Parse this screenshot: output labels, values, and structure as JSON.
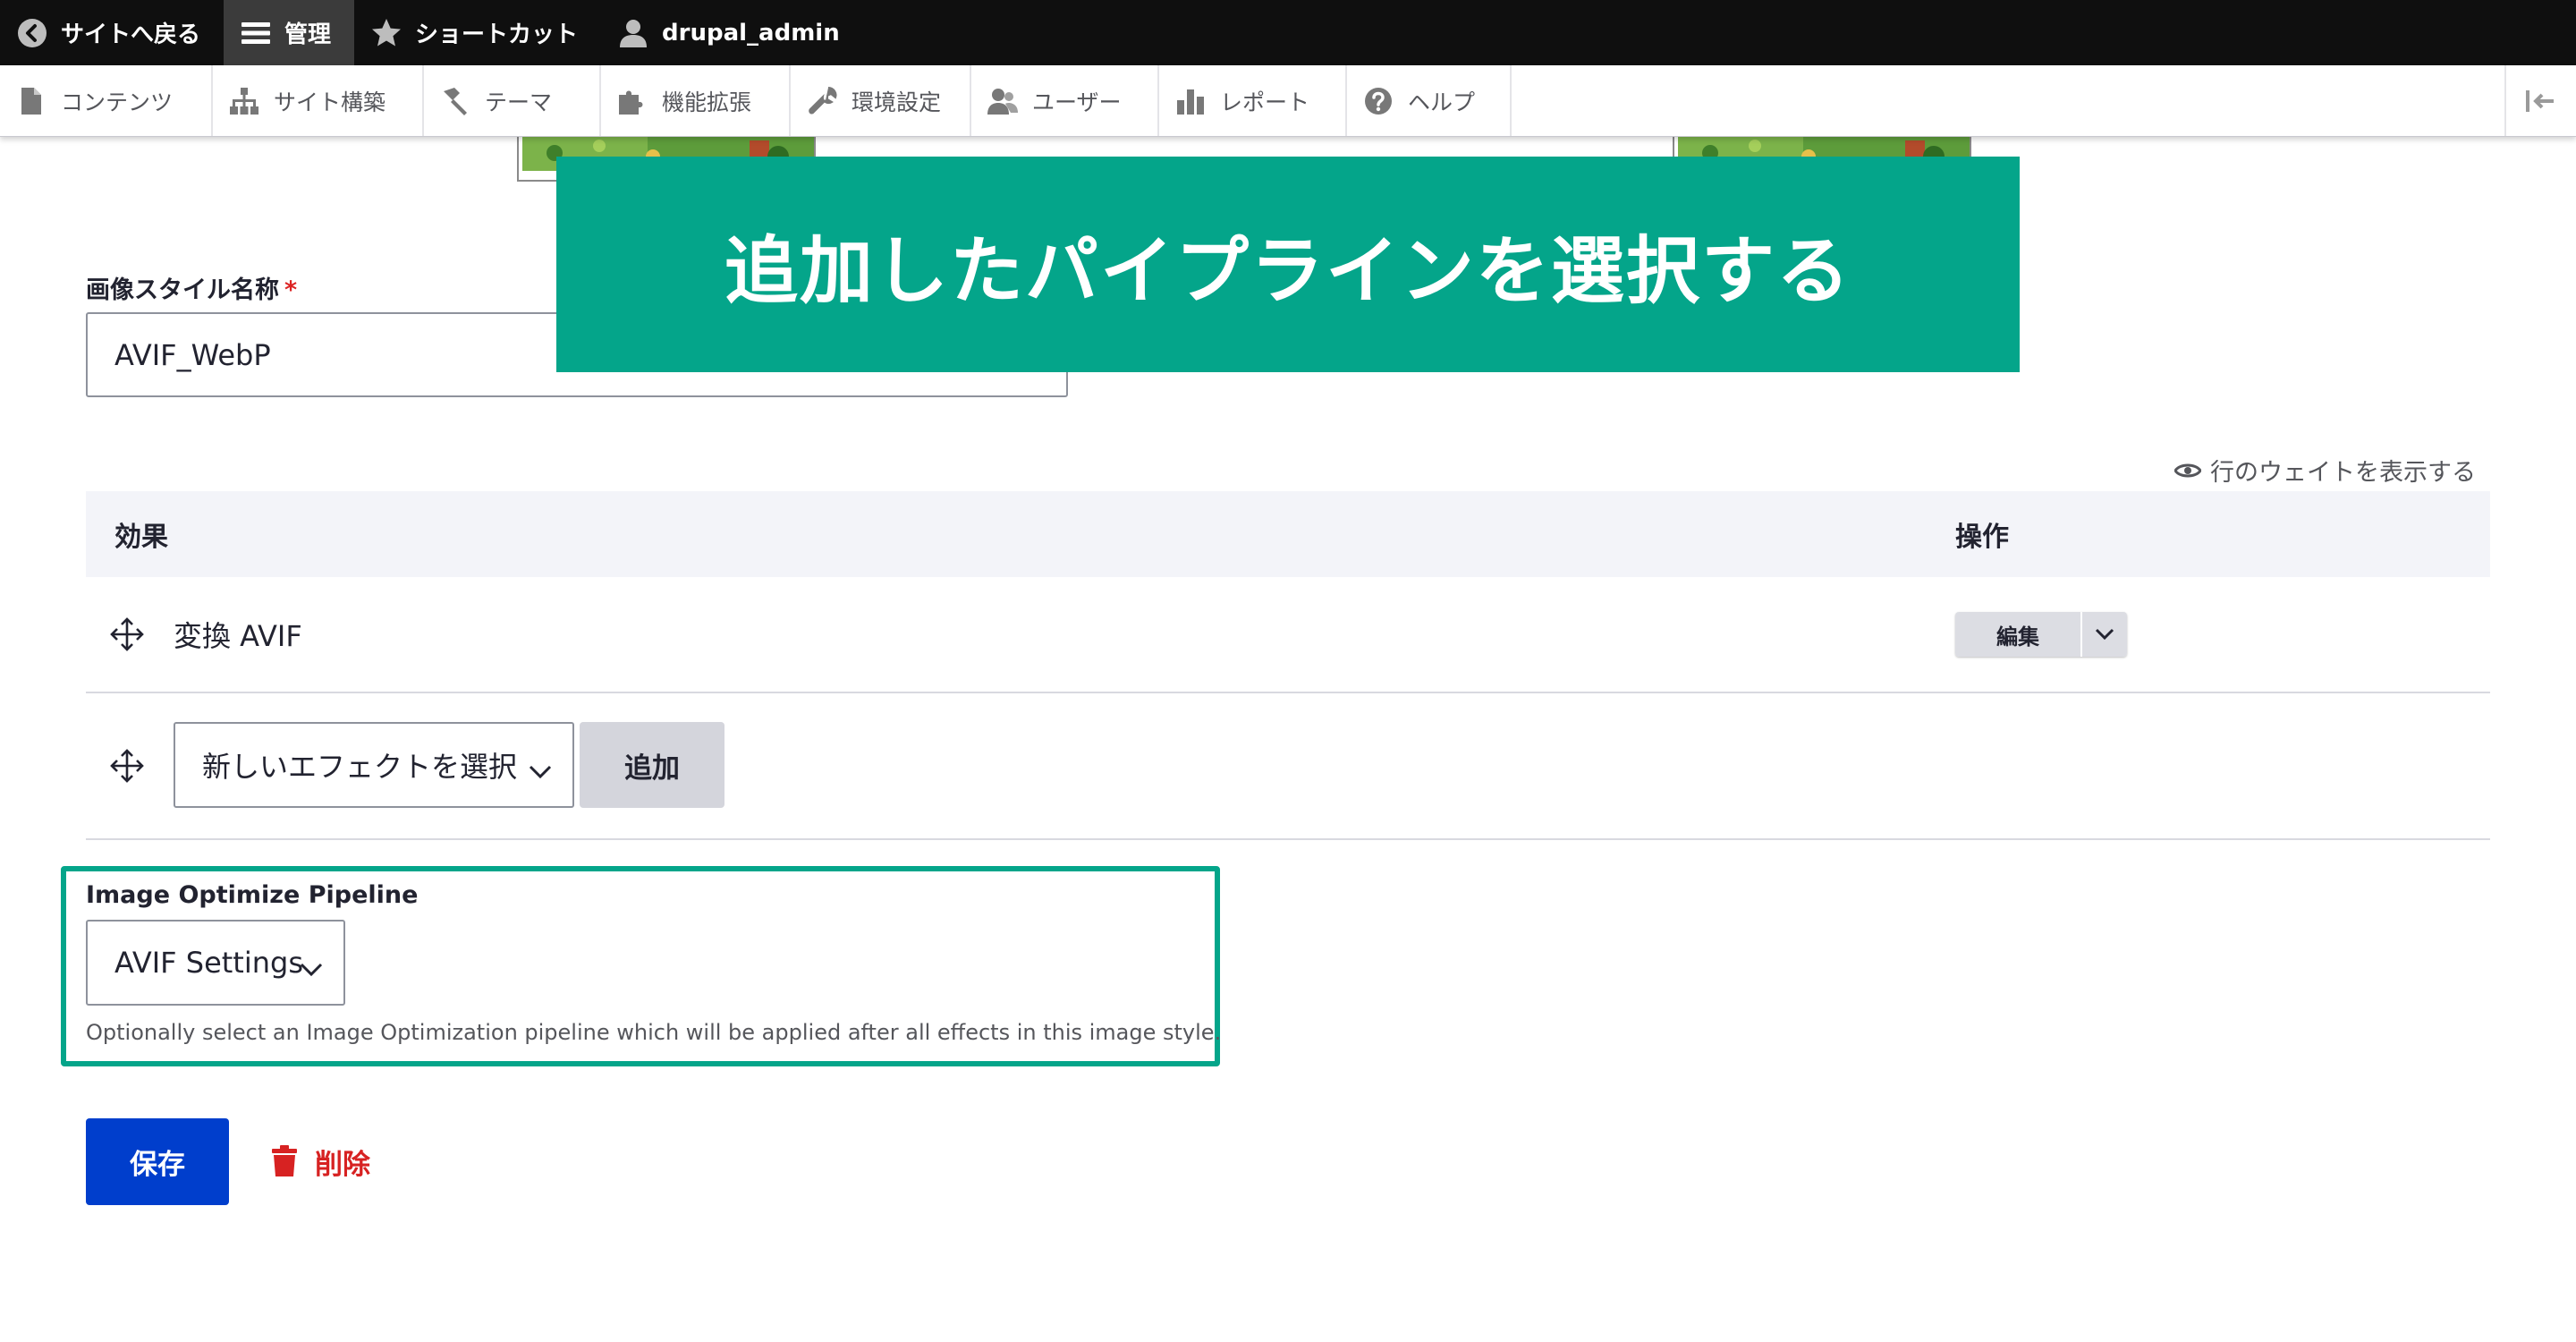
{
  "admin_bar": {
    "back_to_site": "サイトへ戻る",
    "manage": "管理",
    "shortcuts": "ショートカット",
    "user": "drupal_admin"
  },
  "tray": {
    "items": [
      {
        "label": "コンテンツ",
        "icon": "file-icon"
      },
      {
        "label": "サイト構築",
        "icon": "sitemap-icon"
      },
      {
        "label": "テーマ",
        "icon": "paintbrush-icon"
      },
      {
        "label": "機能拡張",
        "icon": "puzzle-icon"
      },
      {
        "label": "環境設定",
        "icon": "wrench-icon"
      },
      {
        "label": "ユーザー",
        "icon": "people-icon"
      },
      {
        "label": "レポート",
        "icon": "bar-chart-icon"
      },
      {
        "label": "ヘルプ",
        "icon": "help-icon"
      }
    ]
  },
  "banner": {
    "text": "追加したパイプラインを選択する"
  },
  "form": {
    "style_name_label": "画像スタイル名称",
    "required_mark": "*",
    "style_name_value": "AVIF_WebP",
    "show_weights": "行のウェイトを表示する",
    "table": {
      "col_effect": "効果",
      "col_operations": "操作",
      "effect_row": {
        "name": "変換 AVIF",
        "edit_label": "編集"
      },
      "new_effect_select": "新しいエフェクトを選択",
      "add_button": "追加"
    },
    "pipeline": {
      "label": "Image Optimize Pipeline",
      "selected": "AVIF Settings",
      "description": "Optionally select an Image Optimization pipeline which will be applied after all effects in this image style."
    },
    "save_button": "保存",
    "delete_link": "削除"
  },
  "colors": {
    "banner": "#04a58a",
    "highlight_border": "#04a58a",
    "primary_button": "#003ecc",
    "danger": "#d72222",
    "admin_bar": "#0f0f0f"
  }
}
